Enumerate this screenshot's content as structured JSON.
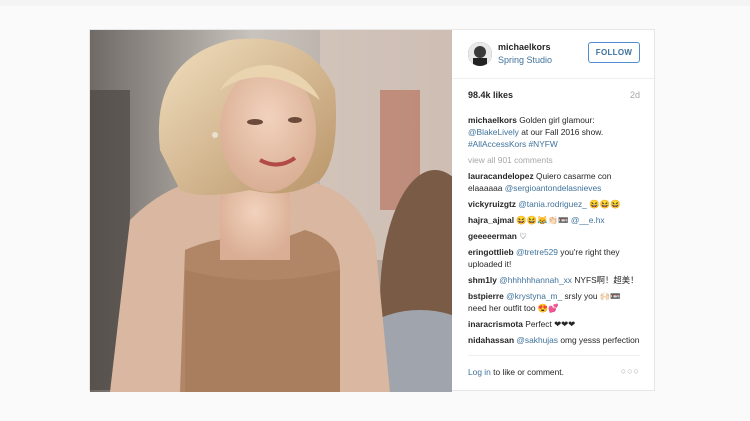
{
  "post": {
    "author": "michaelkors",
    "location": "Spring Studio",
    "follow_label": "FOLLOW",
    "likes": "98.4k likes",
    "age": "2d",
    "caption": {
      "author": "michaelkors",
      "text_before": "Golden girl glamour:",
      "mention": "@BlakeLively",
      "text_after": "at our Fall 2016 show.",
      "hashtags": "#AllAccessKors #NYFW"
    },
    "view_all": "view all 901 comments",
    "comments": [
      {
        "user": "lauracandelopez",
        "text": "Quiero casarme con elaaaaaa",
        "mention": "@sergioantondelasnieves",
        "text2": ""
      },
      {
        "user": "vickyruizgtz",
        "text": "",
        "mention": "@tania.rodriguez_",
        "text2": "😆😆😆"
      },
      {
        "user": "hajra_ajmal",
        "text": "😆😆😹👏🏻📼",
        "mention": "@__e.hx",
        "text2": ""
      },
      {
        "user": "geeeeerman",
        "text": "♡",
        "mention": "",
        "text2": ""
      },
      {
        "user": "eringottlieb",
        "text": "",
        "mention": "@tretre529",
        "text2": "you're right they uploaded it!"
      },
      {
        "user": "shm1ly",
        "text": "",
        "mention": "@hhhhhhannah_xx",
        "text2": "NYFS啊！超美！"
      },
      {
        "user": "bstpierre",
        "text": "",
        "mention": "@krystyna_m_",
        "text2": "srsly you 🙌🏻📼 need her outfit too 😍💕"
      },
      {
        "user": "inaracrismota",
        "text": "Perfect ❤❤❤",
        "mention": "",
        "text2": ""
      },
      {
        "user": "nidahassan",
        "text": "",
        "mention": "@sakhujas",
        "text2": "omg yesss perfection"
      }
    ],
    "login_link": "Log in",
    "login_text": "to like or comment.",
    "more_label": "○○○"
  },
  "icons": {
    "more": "more-options-icon",
    "avatar": "profile-avatar"
  },
  "colors": {
    "link": "#3f729b",
    "follow_border": "#4e8ed1",
    "muted": "#a5a7aa"
  }
}
